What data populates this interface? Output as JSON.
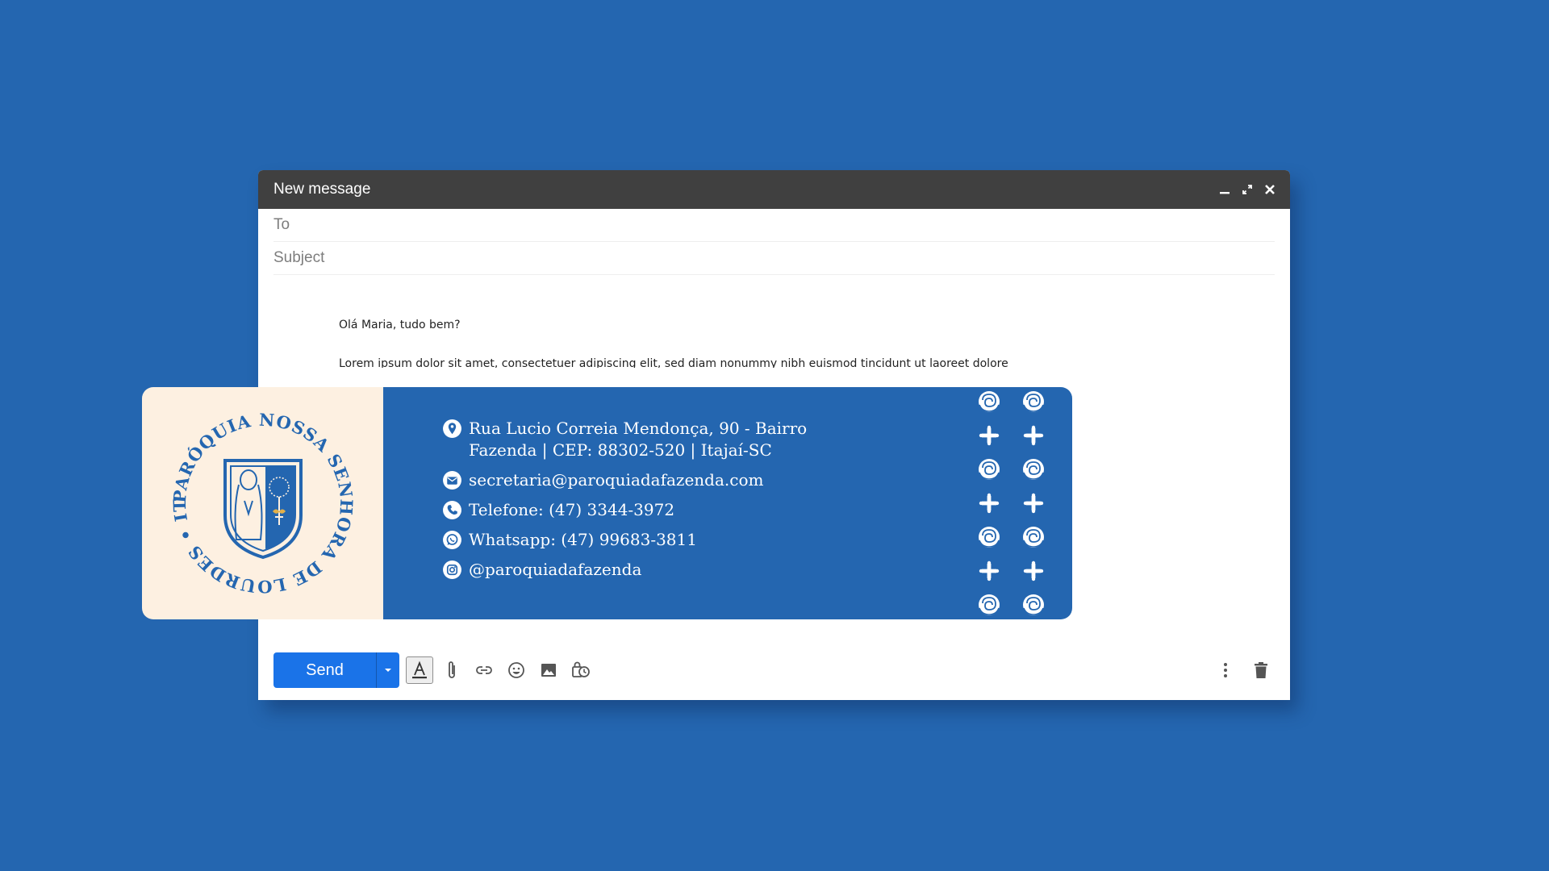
{
  "window": {
    "title": "New message"
  },
  "fields": {
    "to_placeholder": "To",
    "subject_placeholder": "Subject"
  },
  "message": {
    "greeting": "Olá Maria, tudo bem?",
    "paragraph": "Lorem ipsum dolor sit amet, consectetuer adipiscing elit, sed diam nonummy nibh euismod tincidunt ut laoreet dolore magna aliquam erat volutpat. Ut wisi enim ad minim veniam, quis nostrud exerci tation ullamcorper suscipit lobortis nisl"
  },
  "signature": {
    "logo": {
      "ring_text": "PARÓQUIA NOSSA SENHORA DE LOURDES • ITAJAÍ-SC •"
    },
    "address_line1": "Rua Lucio Correia Mendonça, 90 - Bairro",
    "address_line2": "Fazenda | CEP: 88302-520 | Itajaí-SC",
    "email": "secretaria@paroquiadafazenda.com",
    "phone": "Telefone: (47) 3344-3972",
    "whatsapp": "Whatsapp: (47) 99683-3811",
    "instagram": "@paroquiadafazenda",
    "colors": {
      "panel_blue": "#2466b0",
      "logo_bg": "#fdf0e1",
      "logo_gold": "#e2b04a"
    }
  },
  "toolbar": {
    "send_label": "Send",
    "icons": [
      "text-format-icon",
      "attach-icon",
      "link-icon",
      "emoji-icon",
      "image-icon",
      "confidential-icon",
      "more-options-icon",
      "trash-icon"
    ]
  },
  "colors": {
    "background": "#2466b0",
    "titlebar": "#404040",
    "send_button": "#1a73e8"
  }
}
